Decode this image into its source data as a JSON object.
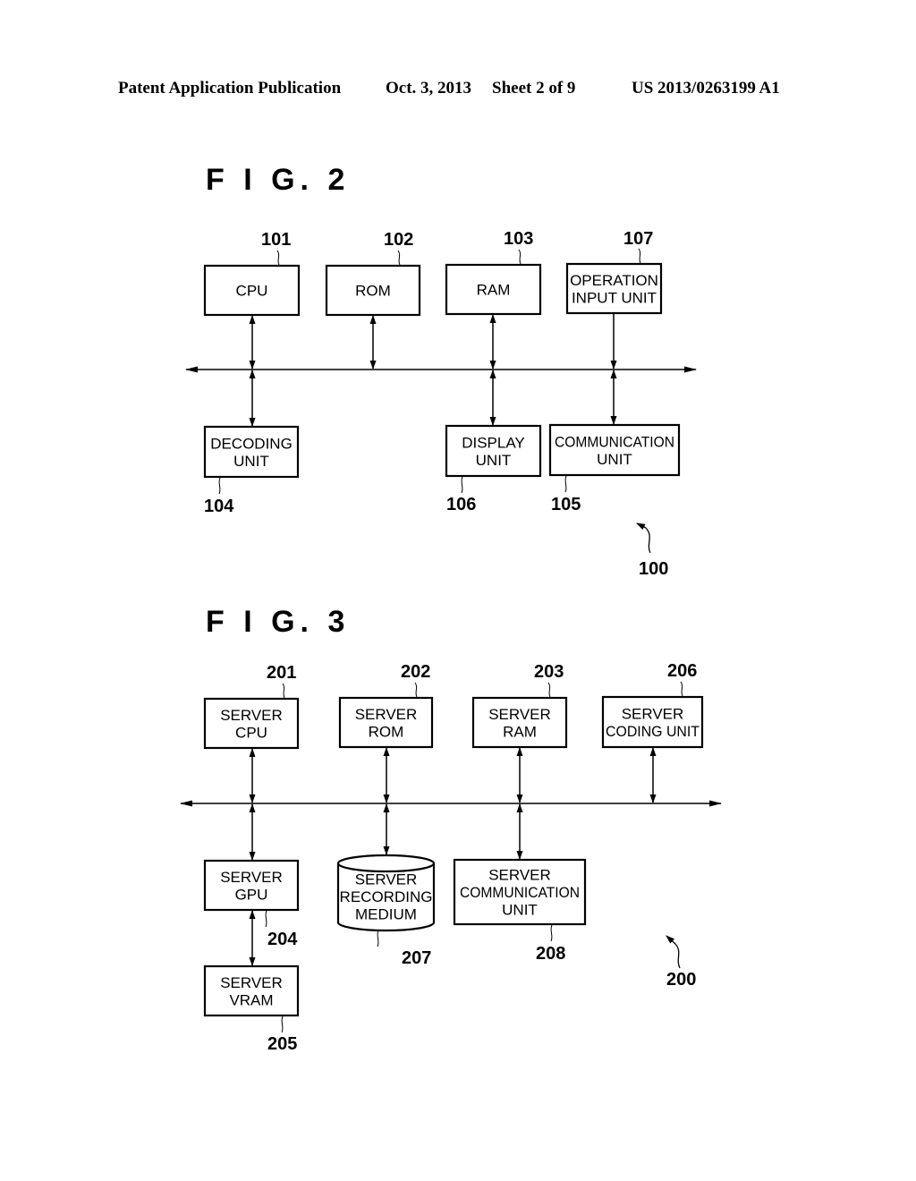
{
  "header": {
    "publication": "Patent Application Publication",
    "date": "Oct. 3, 2013",
    "sheet": "Sheet 2 of 9",
    "number": "US 2013/0263199 A1"
  },
  "figures": [
    {
      "id": "fig2",
      "title": "F I G. 2",
      "system_ref": "100",
      "blocks": [
        {
          "ref": "101",
          "lines": [
            "CPU"
          ],
          "connection": "bidirectional"
        },
        {
          "ref": "102",
          "lines": [
            "ROM"
          ],
          "connection": "bidirectional"
        },
        {
          "ref": "103",
          "lines": [
            "RAM"
          ],
          "connection": "bidirectional"
        },
        {
          "ref": "107",
          "lines": [
            "OPERATION",
            "INPUT UNIT"
          ],
          "connection": "to-bus"
        },
        {
          "ref": "104",
          "lines": [
            "DECODING",
            "UNIT"
          ],
          "connection": "bidirectional"
        },
        {
          "ref": "106",
          "lines": [
            "DISPLAY",
            "UNIT"
          ],
          "connection": "bidirectional"
        },
        {
          "ref": "105",
          "lines": [
            "COMMUNICATION",
            "UNIT"
          ],
          "connection": "bidirectional"
        }
      ]
    },
    {
      "id": "fig3",
      "title": "F I G. 3",
      "system_ref": "200",
      "blocks": [
        {
          "ref": "201",
          "lines": [
            "SERVER",
            "CPU"
          ],
          "connection": "bidirectional"
        },
        {
          "ref": "202",
          "lines": [
            "SERVER",
            "ROM"
          ],
          "connection": "bidirectional"
        },
        {
          "ref": "203",
          "lines": [
            "SERVER",
            "RAM"
          ],
          "connection": "bidirectional"
        },
        {
          "ref": "206",
          "lines": [
            "SERVER",
            "CODING UNIT"
          ],
          "connection": "bidirectional"
        },
        {
          "ref": "204",
          "lines": [
            "SERVER",
            "GPU"
          ],
          "connection": "bidirectional"
        },
        {
          "ref": "207",
          "lines": [
            "SERVER",
            "RECORDING",
            "MEDIUM"
          ],
          "connection": "bidirectional",
          "shape": "cylinder"
        },
        {
          "ref": "208",
          "lines": [
            "SERVER",
            "COMMUNICATION",
            "UNIT"
          ],
          "connection": "bidirectional"
        },
        {
          "ref": "205",
          "lines": [
            "SERVER",
            "VRAM"
          ],
          "connection": "bidirectional-to-gpu"
        }
      ]
    }
  ]
}
